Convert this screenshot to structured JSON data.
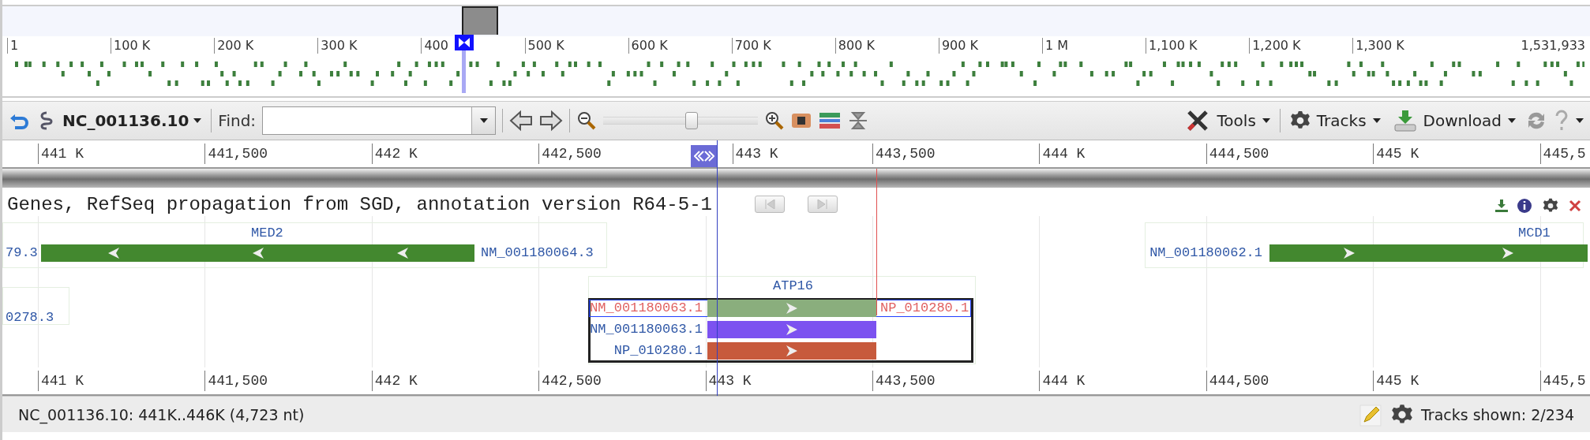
{
  "overview": {
    "ruler_labels": [
      "1",
      "100 K",
      "200 K",
      "300 K",
      "400",
      "500 K",
      "600 K",
      "700 K",
      "800 K",
      "900 K",
      "1 M",
      "1,100 K",
      "1,200 K",
      "1,300 K"
    ],
    "end_label": "1,531,933"
  },
  "toolbar": {
    "sequence": "NC_001136.10",
    "find_label": "Find:",
    "zoom": {
      "level": 0.57
    },
    "tools": "Tools",
    "tracks": "Tracks",
    "download": "Download"
  },
  "ruler_labels": [
    "441 K",
    "441,500",
    "442 K",
    "442,500",
    "443 K",
    "443,500",
    "444 K",
    "444,500",
    "445 K",
    "445,5"
  ],
  "track": {
    "title": "Genes, RefSeq propagation from SGD, annotation version R64-5-1",
    "genes": [
      {
        "kind": "gene",
        "name": "MED2",
        "left_label": "79.3",
        "right_label": "NM_001180064.3",
        "reverse_strand": true,
        "color": "#43882f"
      },
      {
        "kind": "gene",
        "name": "MCD1",
        "left_label": "NM_001180062.1",
        "reverse_strand": false,
        "color": "#43882f"
      },
      {
        "kind": "fragment",
        "left_label": "0278.3"
      },
      {
        "kind": "group",
        "name": "ATP16",
        "selected": true,
        "rows": [
          {
            "left_label": "NM_001180063.1",
            "right_label": "NP_010280.1",
            "highlighted": true,
            "color": "#8aae7d"
          },
          {
            "left_label": "NM_001180063.1",
            "highlighted": false,
            "color": "#7c52f0"
          },
          {
            "left_label": "NP_010280.1",
            "highlighted": false,
            "color": "#c75a3c"
          }
        ]
      }
    ]
  },
  "bottom_ruler_labels": [
    "441 K",
    "441,500",
    "442 K",
    "442,500",
    "443 K",
    "443,500",
    "444 K",
    "444,500",
    "445 K",
    "445,5"
  ],
  "status_bar": {
    "location": "NC_001136.10: 441K..446K (4,723 nt)",
    "tracks_shown": "Tracks shown: 2/234"
  }
}
